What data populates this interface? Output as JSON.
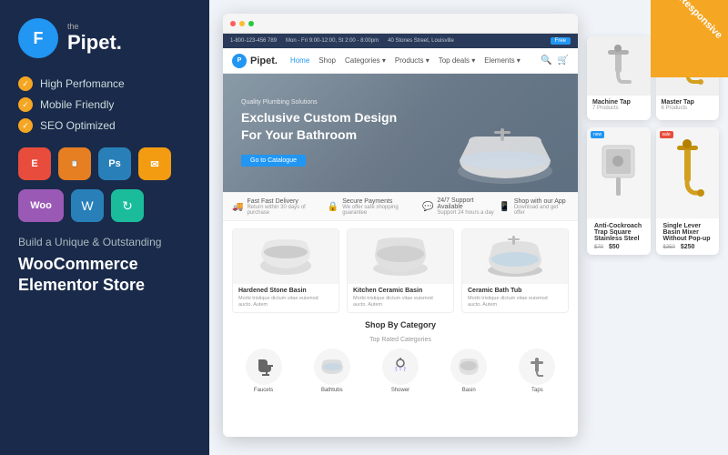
{
  "left": {
    "logo": {
      "the": "the",
      "name": "Pipet."
    },
    "features": [
      {
        "label": "High Perfomance"
      },
      {
        "label": "Mobile Friendly"
      },
      {
        "label": "SEO Optimized"
      }
    ],
    "plugins": [
      {
        "name": "E",
        "type": "elementor",
        "label": "Elementor"
      },
      {
        "name": "📋",
        "type": "forms",
        "label": "Forms"
      },
      {
        "name": "Ps",
        "type": "ps",
        "label": "Photoshop"
      },
      {
        "name": "✉",
        "type": "mailchimp",
        "label": "Mailchimp"
      }
    ],
    "plugins2": [
      {
        "name": "Woo",
        "type": "woo",
        "label": "WooCommerce"
      },
      {
        "name": "W",
        "type": "wp",
        "label": "WordPress"
      },
      {
        "name": "↻",
        "type": "refresh",
        "label": "Updates"
      }
    ],
    "tagline": "Build a Unique & Outstanding",
    "tagline_bold": "WooCommerce Elementor Store"
  },
  "browser": {
    "top_bar": {
      "contact": "1-800-123-456 789",
      "hours": "Mon - Fri 9:00-12:00, St 2:00 - 8:00pm",
      "address": "40 Stones Street, Louisville",
      "cta": "Free"
    },
    "nav": {
      "logo": "Pipet.",
      "links": [
        "Home",
        "Shop",
        "Categories",
        "Products",
        "Top deals",
        "Elements"
      ],
      "active": "Home"
    },
    "hero": {
      "subtitle": "Quality Plumbing Solutions",
      "title": "Exclusive Custom Design\nFor Your Bathroom",
      "btn": "Go to Catalogue"
    },
    "features_bar": [
      {
        "icon": "🚚",
        "title": "Fast Fast Delivery",
        "desc": "Return within 30 days of purchase"
      },
      {
        "icon": "🔒",
        "title": "Secure Payments",
        "desc": "We offer safe shopping guarantee"
      },
      {
        "icon": "💬",
        "title": "24/7 Support Available",
        "desc": "Support 24 hours a day"
      },
      {
        "icon": "📱",
        "title": "Shop with our App",
        "desc": "Download and get offer"
      }
    ],
    "products": [
      {
        "name": "Hardened Stone Basin",
        "desc": "Morbi tristique dictum vitae euismod aucto. Autem"
      },
      {
        "name": "Kitchen Ceramic Basin",
        "desc": "Morbi tristique dictum vitae euismod aucto. Autem"
      },
      {
        "name": "Ceramic Bath Tub",
        "desc": "Morbi tristique dictum vitae euismod aucto. Autem"
      }
    ],
    "categories_section": {
      "title": "Shop By Category",
      "subtitle": "Top Rated Categories",
      "items": [
        {
          "label": "Faucets"
        },
        {
          "label": "Bathtubs"
        },
        {
          "label": "Shower"
        },
        {
          "label": "Basin"
        },
        {
          "label": "Taps"
        }
      ]
    },
    "right_cards_top": [
      {
        "name": "Machine Tap",
        "count": "7 Products",
        "badge": ""
      },
      {
        "name": "Master Tap",
        "count": "6 Products",
        "badge": ""
      }
    ],
    "right_cards_bottom": [
      {
        "name": "Anti-Cockroach Trap Square Stainless Steel",
        "price_old": "$70",
        "price_new": "$50",
        "badge": "new"
      },
      {
        "name": "Single Lever Basin Mixer Without Pop-up",
        "price_old": "$350",
        "price_new": "$250",
        "badge": "sale"
      }
    ]
  },
  "badge": {
    "text": "Responsive"
  }
}
